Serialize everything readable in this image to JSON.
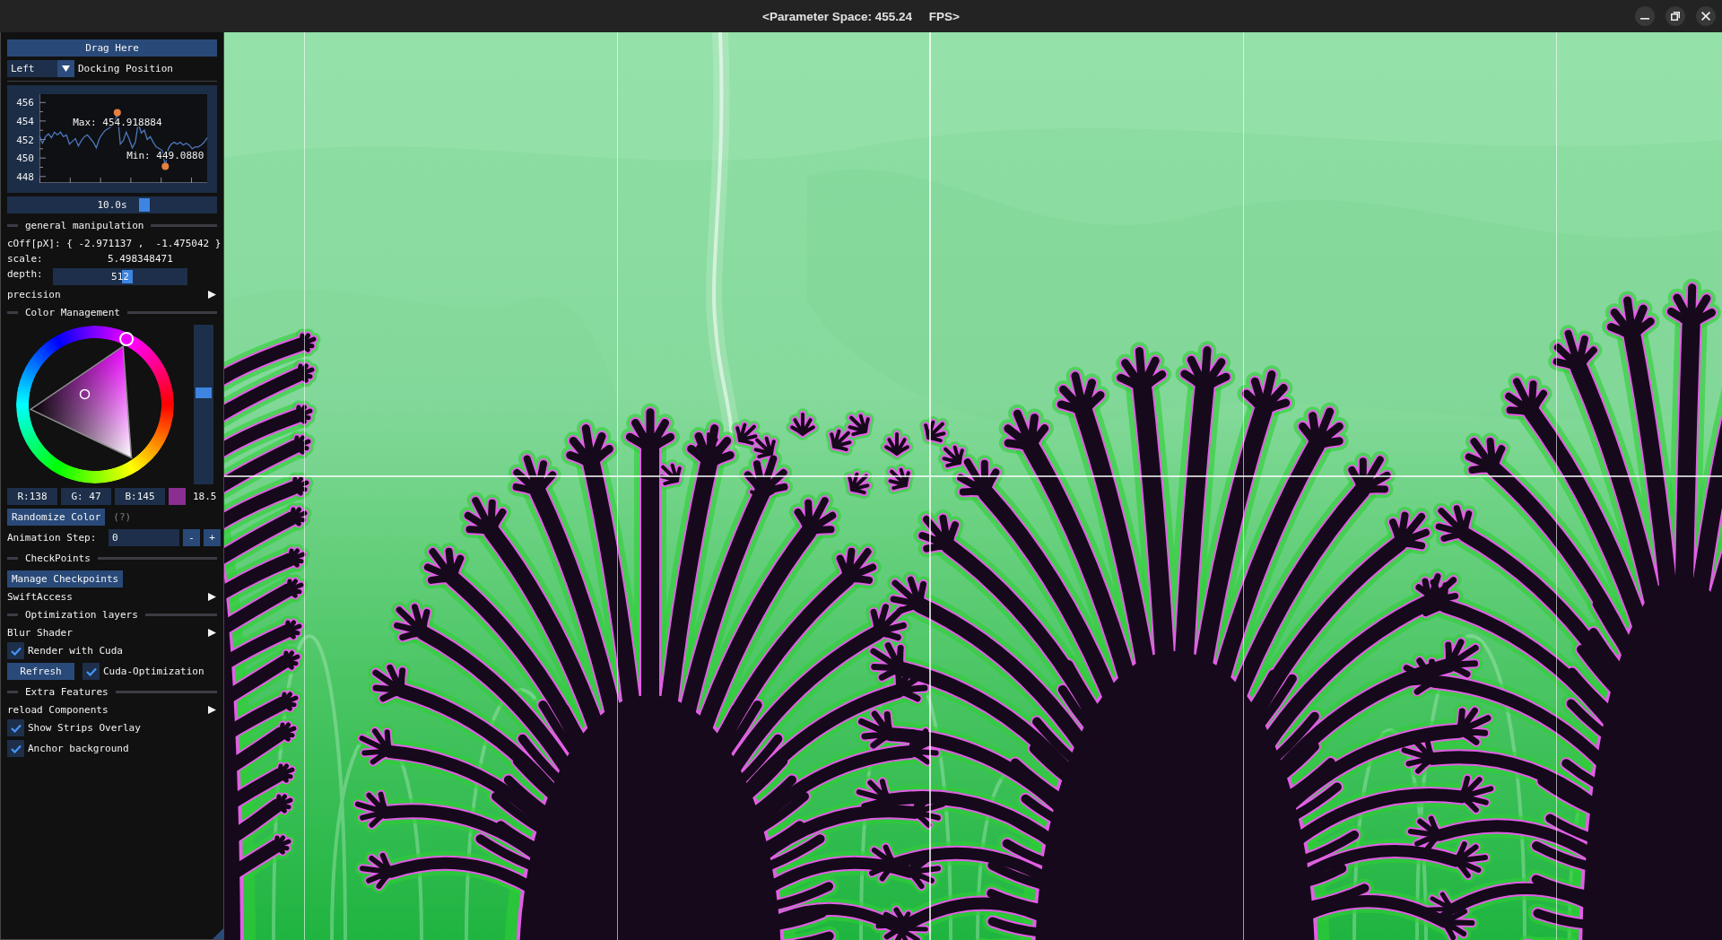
{
  "window": {
    "title": "<Parameter Space: 455.24     FPS>"
  },
  "panel": {
    "items": [
      {
        "kind": "handle",
        "label": "Drag Here"
      },
      {
        "kind": "combo",
        "value": "Left",
        "label": "Docking Position"
      },
      {
        "kind": "rule"
      },
      {
        "kind": "plot",
        "chart_data": {
          "type": "line",
          "values": [
            452.4,
            451.6,
            452.3,
            452.6,
            452.2,
            452.8,
            452.5,
            452.8,
            452.3,
            452.5,
            451.5,
            451.8,
            452.1,
            451.3,
            451.9,
            452.3,
            452.5,
            452.1,
            451.7,
            451.1,
            452.1,
            452.6,
            453,
            453.2,
            453.4,
            453.7,
            454.9,
            451.5,
            451.9,
            452.8,
            452,
            451.1,
            451.7,
            453.8,
            452.7,
            453,
            452,
            452.3,
            451.7,
            451.2,
            451,
            450.8,
            449.1,
            451,
            451.5,
            451.7,
            451.5,
            451.7,
            451.4,
            451.6,
            451.4,
            451,
            451.2,
            451.2,
            451.4,
            451.7,
            452.2
          ],
          "ylim": [
            447.3,
            456.9
          ],
          "yticks": [
            448,
            450,
            452,
            454,
            456
          ]
        },
        "markers": [
          {
            "kind": "max",
            "label": "Max: 454.918884"
          },
          {
            "kind": "min",
            "label": "Min: 449.0880"
          }
        ]
      },
      {
        "kind": "slider",
        "value": "10.0s",
        "level": 0.66
      },
      {
        "kind": "section",
        "label": "general manipulation"
      },
      {
        "kind": "text",
        "label": "cOff[pX]: { -2.971137 ,  -1.475042 }"
      },
      {
        "kind": "value",
        "label": "scale:",
        "value": "5.498348471"
      },
      {
        "kind": "slider",
        "label": "depth:",
        "value": "512",
        "level": 0.56
      },
      {
        "kind": "tree",
        "label": "precision",
        "expanded": false
      },
      {
        "kind": "section",
        "label": "Color Management"
      },
      {
        "kind": "color_picker",
        "color": "#8a2f91",
        "channels": [
          "R:138",
          "G: 47",
          "B:145"
        ],
        "reading": "18.5",
        "level": 0.58
      },
      {
        "kind": "row",
        "items": [
          {
            "kind": "button",
            "label": "Randomize Color"
          },
          {
            "kind": "help",
            "label": "(?)"
          }
        ]
      },
      {
        "kind": "row",
        "items": [
          {
            "kind": "label",
            "label": "Animation Step:"
          },
          {
            "kind": "input",
            "value": "0"
          },
          {
            "kind": "small_button",
            "label": "-"
          },
          {
            "kind": "small_button",
            "label": "+"
          }
        ]
      },
      {
        "kind": "section",
        "label": "CheckPoints"
      },
      {
        "kind": "row",
        "items": [
          {
            "kind": "button",
            "label": "Manage Checkpoints"
          }
        ]
      },
      {
        "kind": "tree",
        "label": "SwiftAccess",
        "expanded": false
      },
      {
        "kind": "section",
        "label": "Optimization layers"
      },
      {
        "kind": "tree",
        "label": "Blur Shader",
        "expanded": false
      },
      {
        "kind": "checkbox",
        "label": "Render with Cuda",
        "checked": true
      },
      {
        "kind": "row",
        "items": [
          {
            "kind": "button",
            "label": "Refresh"
          },
          {
            "kind": "checkbox",
            "label": "Cuda-Optimization",
            "checked": true
          }
        ]
      },
      {
        "kind": "section",
        "label": "Extra Features"
      },
      {
        "kind": "tree",
        "label": "reload Components",
        "expanded": false
      },
      {
        "kind": "checkbox",
        "label": "Show Strips Overlay",
        "checked": true
      },
      {
        "kind": "checkbox",
        "label": "Anchor background",
        "checked": true
      }
    ]
  }
}
